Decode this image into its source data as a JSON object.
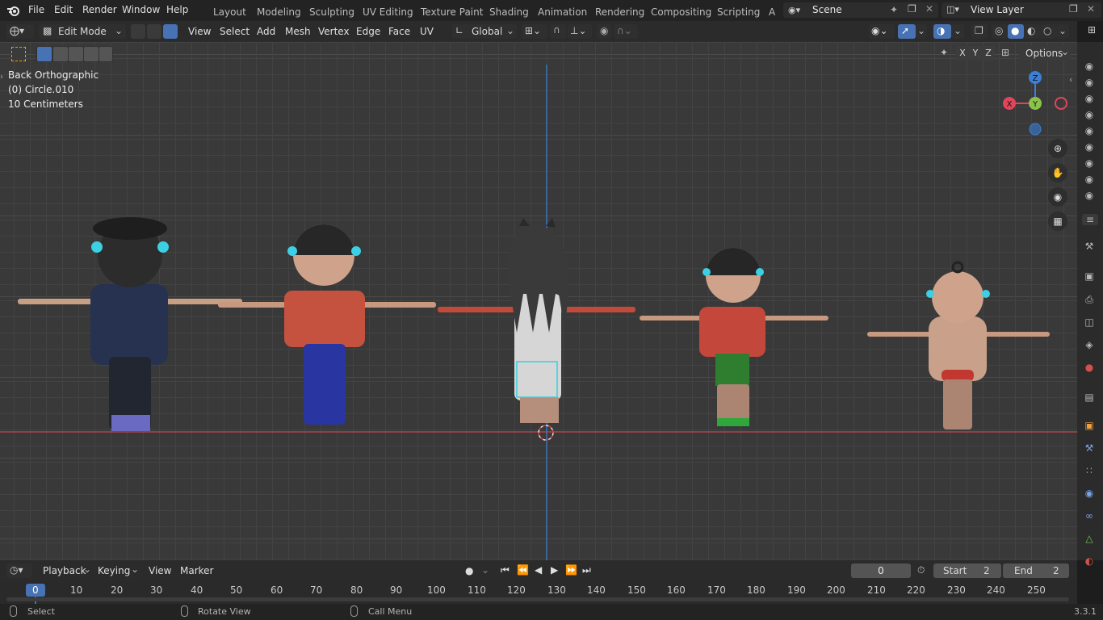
{
  "menu": [
    "File",
    "Edit",
    "Render",
    "Window",
    "Help"
  ],
  "workspaces": [
    "Layout",
    "Modeling",
    "Sculpting",
    "UV Editing",
    "Texture Paint",
    "Shading",
    "Animation",
    "Rendering",
    "Compositing",
    "Scripting",
    "A"
  ],
  "scene": {
    "label": "Scene"
  },
  "view_layer": {
    "label": "View Layer"
  },
  "header": {
    "mode": "Edit Mode",
    "menus": [
      "View",
      "Select",
      "Add",
      "Mesh",
      "Vertex",
      "Edge",
      "Face",
      "UV"
    ],
    "orientation": "Global",
    "axis_x": "X",
    "axis_y": "Y",
    "axis_z": "Z",
    "options": "Options"
  },
  "viewport": {
    "view_name": "Back Orthographic",
    "object": "(0) Circle.010",
    "scale": "10 Centimeters",
    "gizmo": {
      "z": "Z",
      "y": "Y",
      "x": "X"
    }
  },
  "timeline": {
    "menus": [
      "Playback",
      "Keying",
      "View",
      "Marker"
    ],
    "current_frame": "0",
    "start_label": "Start",
    "start_value": "2",
    "end_label": "End",
    "end_value": "2",
    "frames": [
      "0",
      "10",
      "20",
      "30",
      "40",
      "50",
      "60",
      "70",
      "80",
      "90",
      "100",
      "110",
      "120",
      "130",
      "140",
      "150",
      "160",
      "170",
      "180",
      "190",
      "200",
      "210",
      "220",
      "230",
      "240",
      "250"
    ]
  },
  "status": {
    "select": "Select",
    "rotate": "Rotate View",
    "call_menu": "Call Menu",
    "version": "3.3.1"
  },
  "colors": {
    "accent": "#4772b3",
    "axis_x": "#e0455a",
    "axis_y": "#8bc34a",
    "axis_z": "#3b7fd6",
    "selection": "#35d0e0"
  }
}
